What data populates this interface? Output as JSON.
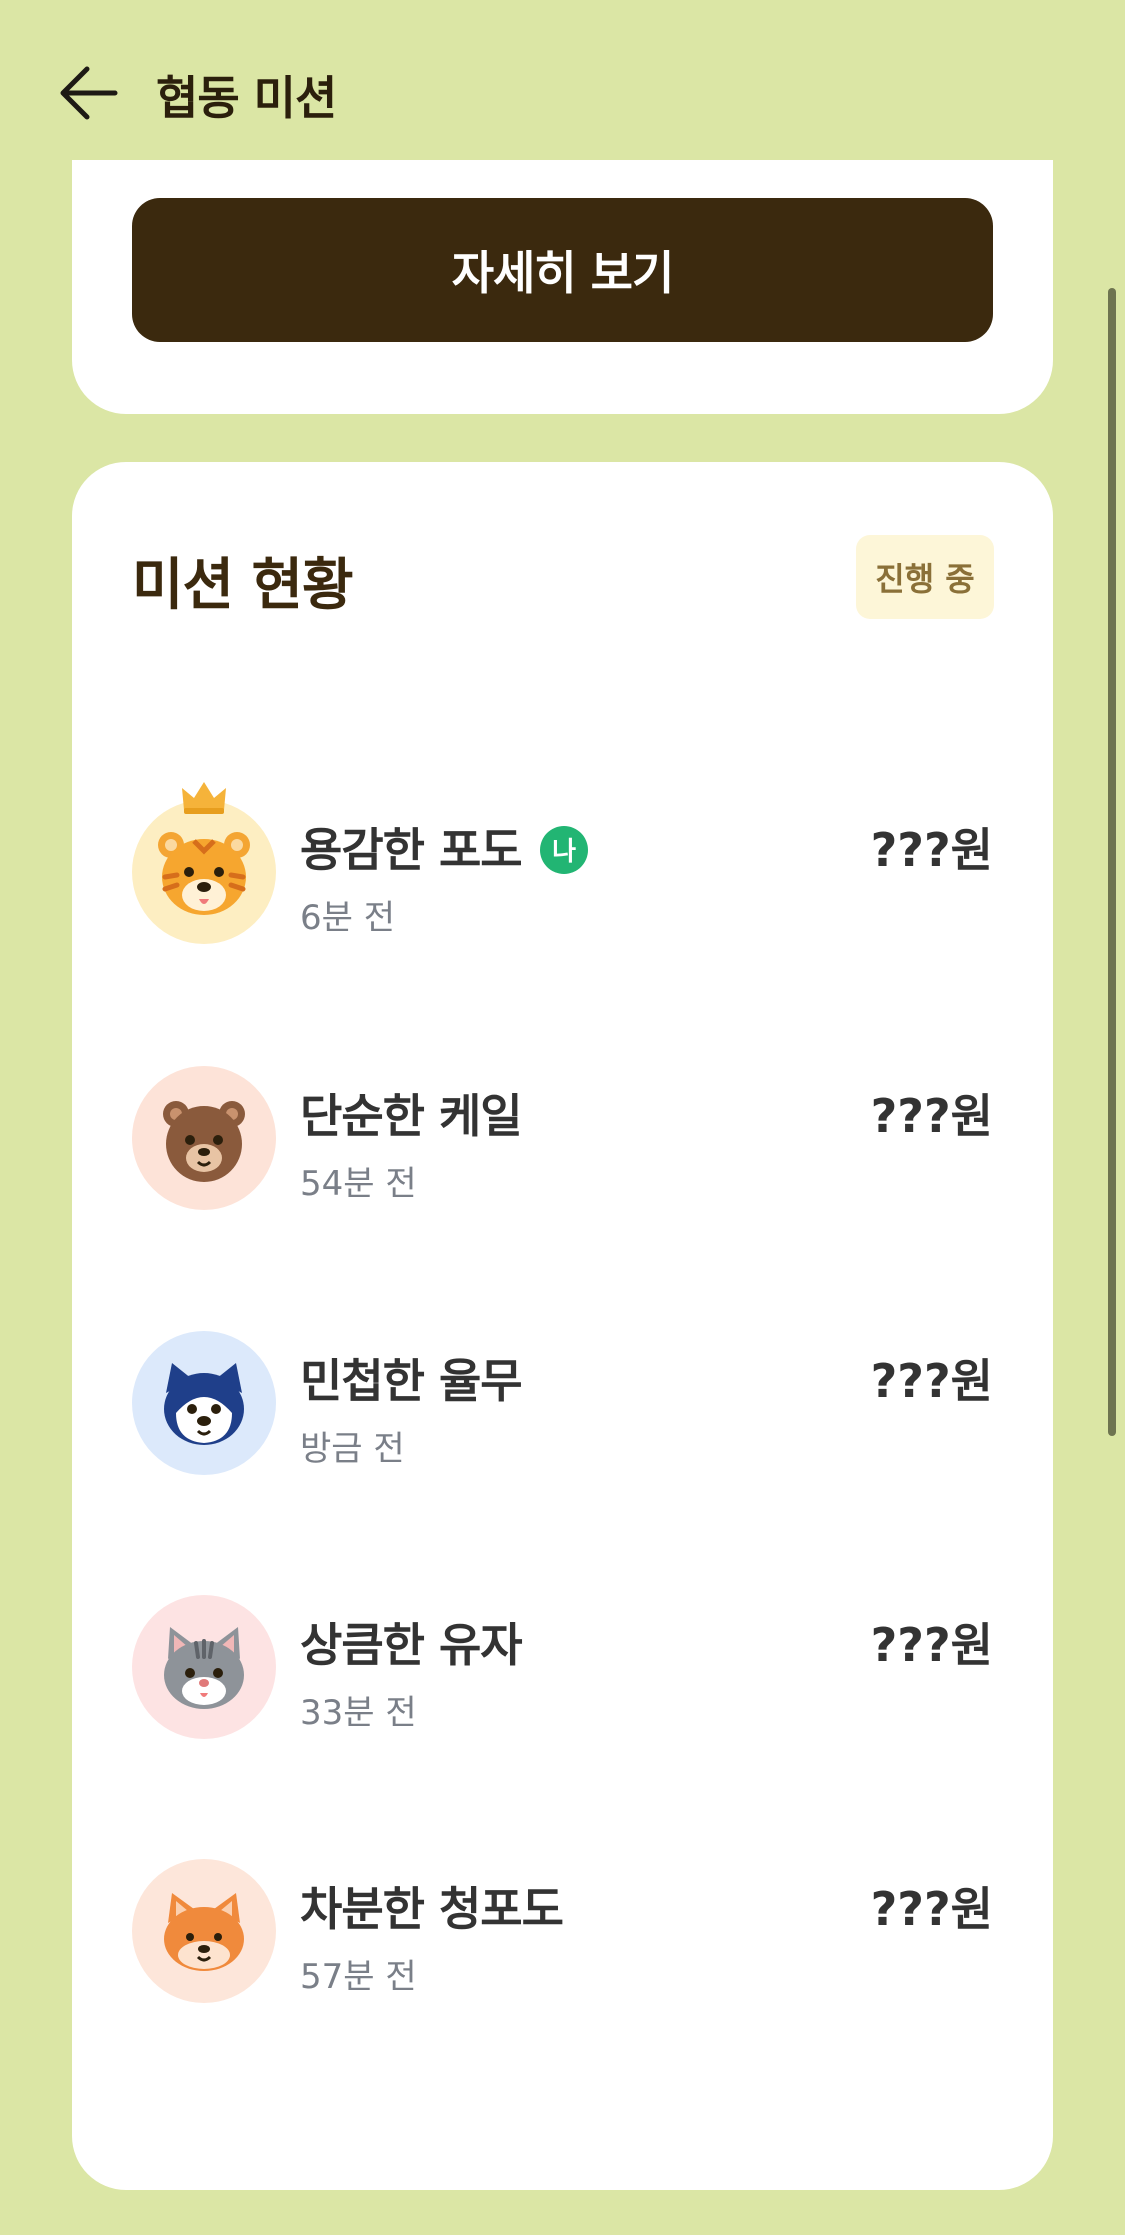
{
  "header": {
    "title": "협동 미션",
    "back_icon": "arrow-left-icon"
  },
  "top_card": {
    "detail_button_label": "자세히 보기"
  },
  "status": {
    "title": "미션 현황",
    "badge": "진행 중"
  },
  "members": [
    {
      "name": "용감한 포도",
      "time": "6분 전",
      "amount": "???원",
      "me_label": "나",
      "avatar": "tiger-avatar-icon",
      "crown": true,
      "ring": "#fdeec2"
    },
    {
      "name": "단순한 케일",
      "time": "54분 전",
      "amount": "???원",
      "avatar": "bear-avatar-icon",
      "ring": "#fde3d8"
    },
    {
      "name": "민첩한 율무",
      "time": "방금 전",
      "amount": "???원",
      "avatar": "husky-avatar-icon",
      "ring": "#dce9fb"
    },
    {
      "name": "상큼한 유자",
      "time": "33분 전",
      "amount": "???원",
      "avatar": "cat-avatar-icon",
      "ring": "#fde3e3"
    },
    {
      "name": "차분한 청포도",
      "time": "57분 전",
      "amount": "???원",
      "avatar": "shiba-avatar-icon",
      "ring": "#fde6da"
    }
  ],
  "colors": {
    "background": "#dbe6a5",
    "primary_button": "#3b290e",
    "me_badge": "#22b573"
  }
}
